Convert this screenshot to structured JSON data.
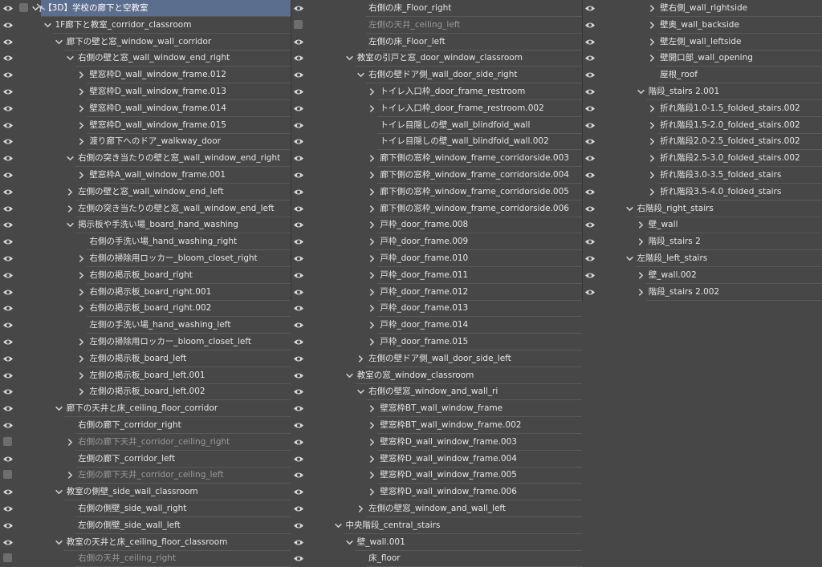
{
  "colors": {
    "background": "#474747",
    "row_line": "#595959",
    "selected": "#5c6e8d",
    "hidden_text": "#9a9a9a"
  },
  "icons": {
    "visible": "eye-icon",
    "hidden": "hidden-layer-box",
    "folder": "chevron-icon",
    "toolbar": [
      "layer-toggle-icon",
      "ik-toggle-icon"
    ]
  },
  "columns": [
    [
      {
        "label": "【3D】学校の廊下と空教室",
        "lvl": 4,
        "chev": "down",
        "sel": true
      },
      {
        "label": "1F廊下と教室_corridor_classroom",
        "lvl": 5,
        "chev": "down"
      },
      {
        "label": "廊下の壁と窓_window_wall_corridor",
        "lvl": 6,
        "chev": "down"
      },
      {
        "label": "右側の壁と窓_wall_window_end_right",
        "lvl": 7,
        "chev": "down"
      },
      {
        "label": "壁窓枠D_wall_window_frame.012",
        "lvl": 8,
        "chev": "right"
      },
      {
        "label": "壁窓枠D_wall_window_frame.013",
        "lvl": 8,
        "chev": "right"
      },
      {
        "label": "壁窓枠D_wall_window_frame.014",
        "lvl": 8,
        "chev": "right"
      },
      {
        "label": "壁窓枠D_wall_window_frame.015",
        "lvl": 8,
        "chev": "right"
      },
      {
        "label": "渡り廊下へのドア_walkway_door",
        "lvl": 8,
        "chev": "right"
      },
      {
        "label": "右側の突き当たりの壁と窓_wall_window_end_right",
        "lvl": 7,
        "chev": "down"
      },
      {
        "label": "壁窓枠A_wall_window_frame.001",
        "lvl": 8,
        "chev": "right"
      },
      {
        "label": "左側の壁と窓_wall_window_end_left",
        "lvl": 7,
        "chev": "right"
      },
      {
        "label": "左側の突き当たりの壁と窓_wall_window_end_left",
        "lvl": 7,
        "chev": "right"
      },
      {
        "label": "掲示板や手洗い場_board_hand_washing",
        "lvl": 7,
        "chev": "down"
      },
      {
        "label": "右側の手洗い場_hand_washing_right",
        "lvl": 8,
        "chev": "none"
      },
      {
        "label": "右側の掃除用ロッカー_bloom_closet_right",
        "lvl": 8,
        "chev": "right"
      },
      {
        "label": "右側の掲示板_board_right",
        "lvl": 8,
        "chev": "right"
      },
      {
        "label": "右側の掲示板_board_right.001",
        "lvl": 8,
        "chev": "right"
      },
      {
        "label": "右側の掲示板_board_right.002",
        "lvl": 8,
        "chev": "right"
      },
      {
        "label": "左側の手洗い場_hand_washing_left",
        "lvl": 8,
        "chev": "none"
      },
      {
        "label": "左側の掃除用ロッカー_bloom_closet_left",
        "lvl": 8,
        "chev": "right"
      },
      {
        "label": "左側の掲示板_board_left",
        "lvl": 8,
        "chev": "right"
      },
      {
        "label": "左側の掲示板_board_left.001",
        "lvl": 8,
        "chev": "right"
      },
      {
        "label": "左側の掲示板_board_left.002",
        "lvl": 8,
        "chev": "right"
      },
      {
        "label": "廊下の天井と床_ceiling_floor_corridor",
        "lvl": 6,
        "chev": "down"
      },
      {
        "label": "右側の廊下_corridor_right",
        "lvl": 7,
        "chev": "none"
      },
      {
        "label": "右側の廊下天井_corridor_ceiling_right",
        "lvl": 7,
        "chev": "right",
        "hidden": true
      },
      {
        "label": "左側の廊下_corridor_left",
        "lvl": 7,
        "chev": "none"
      },
      {
        "label": "左側の廊下天井_corridor_ceiling_left",
        "lvl": 7,
        "chev": "right",
        "hidden": true
      },
      {
        "label": "教室の側壁_side_wall_classroom",
        "lvl": 6,
        "chev": "down"
      },
      {
        "label": "右側の側壁_side_wall_right",
        "lvl": 7,
        "chev": "none"
      },
      {
        "label": "左側の側壁_side_wall_left",
        "lvl": 7,
        "chev": "none"
      },
      {
        "label": "教室の天井と床_ceiling_floor_classroom",
        "lvl": 6,
        "chev": "down"
      },
      {
        "label": "右側の天井_ceiling_right",
        "lvl": 7,
        "chev": "none",
        "hidden": true
      }
    ],
    [
      {
        "label": "右側の床_Floor_right",
        "lvl": 7,
        "chev": "none"
      },
      {
        "label": "左側の天井_ceiling_left",
        "lvl": 7,
        "chev": "none",
        "hidden": true
      },
      {
        "label": "左側の床_Floor_left",
        "lvl": 7,
        "chev": "none"
      },
      {
        "label": "教室の引戸と窓_door_window_classroom",
        "lvl": 6,
        "chev": "down"
      },
      {
        "label": "右側の壁ドア側_wall_door_side_right",
        "lvl": 7,
        "chev": "down"
      },
      {
        "label": "トイレ入口枠_door_frame_restroom",
        "lvl": 8,
        "chev": "right"
      },
      {
        "label": "トイレ入口枠_door_frame_restroom.002",
        "lvl": 8,
        "chev": "right"
      },
      {
        "label": "トイレ目隠しの壁_wall_blindfold_wall",
        "lvl": 8,
        "chev": "none"
      },
      {
        "label": "トイレ目隠しの壁_wall_blindfold_wall.002",
        "lvl": 8,
        "chev": "none"
      },
      {
        "label": "廊下側の窓枠_window_frame_corridorside.003",
        "lvl": 8,
        "chev": "right"
      },
      {
        "label": "廊下側の窓枠_window_frame_corridorside.004",
        "lvl": 8,
        "chev": "right"
      },
      {
        "label": "廊下側の窓枠_window_frame_corridorside.005",
        "lvl": 8,
        "chev": "right"
      },
      {
        "label": "廊下側の窓枠_window_frame_corridorside.006",
        "lvl": 8,
        "chev": "right"
      },
      {
        "label": "戸枠_door_frame.008",
        "lvl": 8,
        "chev": "right"
      },
      {
        "label": "戸枠_door_frame.009",
        "lvl": 8,
        "chev": "right"
      },
      {
        "label": "戸枠_door_frame.010",
        "lvl": 8,
        "chev": "right"
      },
      {
        "label": "戸枠_door_frame.011",
        "lvl": 8,
        "chev": "right"
      },
      {
        "label": "戸枠_door_frame.012",
        "lvl": 8,
        "chev": "right"
      },
      {
        "label": "戸枠_door_frame.013",
        "lvl": 8,
        "chev": "right"
      },
      {
        "label": "戸枠_door_frame.014",
        "lvl": 8,
        "chev": "right"
      },
      {
        "label": "戸枠_door_frame.015",
        "lvl": 8,
        "chev": "right"
      },
      {
        "label": "左側の壁ドア側_wall_door_side_left",
        "lvl": 7,
        "chev": "right"
      },
      {
        "label": "教室の窓_window_classroom",
        "lvl": 6,
        "chev": "down"
      },
      {
        "label": "右側の壁窓_window_and_wall_ri",
        "lvl": 7,
        "chev": "down"
      },
      {
        "label": "壁窓枠BT_wall_window_frame",
        "lvl": 8,
        "chev": "right"
      },
      {
        "label": "壁窓枠BT_wall_window_frame.002",
        "lvl": 8,
        "chev": "right"
      },
      {
        "label": "壁窓枠D_wall_window_frame.003",
        "lvl": 8,
        "chev": "right"
      },
      {
        "label": "壁窓枠D_wall_window_frame.004",
        "lvl": 8,
        "chev": "right"
      },
      {
        "label": "壁窓枠D_wall_window_frame.005",
        "lvl": 8,
        "chev": "right"
      },
      {
        "label": "壁窓枠D_wall_window_frame.006",
        "lvl": 8,
        "chev": "right"
      },
      {
        "label": "左側の壁窓_window_and_wall_left",
        "lvl": 7,
        "chev": "right"
      },
      {
        "label": "中央階段_central_stairs",
        "lvl": 5,
        "chev": "down"
      },
      {
        "label": "壁_wall.001",
        "lvl": 6,
        "chev": "down"
      },
      {
        "label": "床_floor",
        "lvl": 7,
        "chev": "none"
      }
    ],
    [
      {
        "label": "壁右側_wall_rightside",
        "lvl": 7,
        "chev": "right"
      },
      {
        "label": "壁奥_wall_backside",
        "lvl": 7,
        "chev": "right"
      },
      {
        "label": "壁左側_wall_leftside",
        "lvl": 7,
        "chev": "right"
      },
      {
        "label": "壁開口部_wall_opening",
        "lvl": 7,
        "chev": "right"
      },
      {
        "label": "屋根_roof",
        "lvl": 7,
        "chev": "none"
      },
      {
        "label": "階段_stairs 2.001",
        "lvl": 6,
        "chev": "down"
      },
      {
        "label": "折れ階段1.0-1.5_folded_stairs.002",
        "lvl": 7,
        "chev": "right"
      },
      {
        "label": "折れ階段1.5-2.0_folded_stairs.002",
        "lvl": 7,
        "chev": "right"
      },
      {
        "label": "折れ階段2.0-2.5_folded_stairs.002",
        "lvl": 7,
        "chev": "right"
      },
      {
        "label": "折れ階段2.5-3.0_folded_stairs.002",
        "lvl": 7,
        "chev": "right"
      },
      {
        "label": "折れ階段3.0-3.5_folded_stairs",
        "lvl": 7,
        "chev": "right"
      },
      {
        "label": "折れ階段3.5-4.0_folded_stairs",
        "lvl": 7,
        "chev": "right"
      },
      {
        "label": "右階段_right_stairs",
        "lvl": 5,
        "chev": "down"
      },
      {
        "label": "壁_wall",
        "lvl": 6,
        "chev": "right"
      },
      {
        "label": "階段_stairs 2",
        "lvl": 6,
        "chev": "right"
      },
      {
        "label": "左階段_left_stairs",
        "lvl": 5,
        "chev": "down"
      },
      {
        "label": "壁_wall.002",
        "lvl": 6,
        "chev": "right"
      },
      {
        "label": "階段_stairs 2.002",
        "lvl": 6,
        "chev": "right"
      }
    ]
  ]
}
